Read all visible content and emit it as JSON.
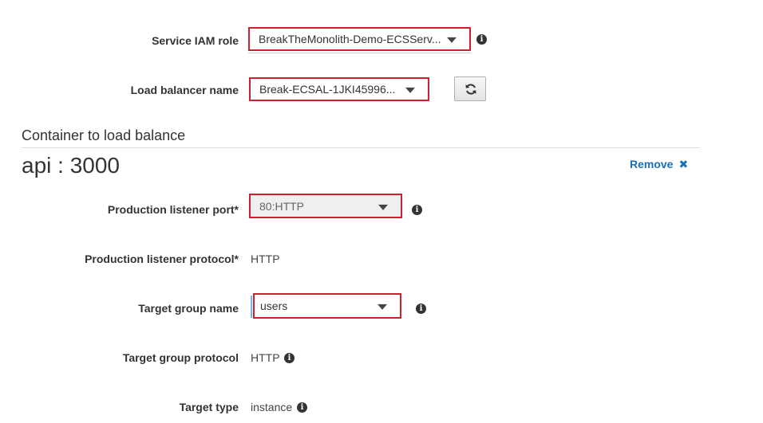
{
  "service_role": {
    "label": "Service IAM role",
    "value": "BreakTheMonolith-Demo-ECSServ..."
  },
  "load_balancer": {
    "label": "Load balancer name",
    "value": "Break-ECSAL-1JKI45996..."
  },
  "section": {
    "title": "Container to load balance",
    "container": "api : 3000",
    "remove_label": "Remove",
    "remove_icon": "✖"
  },
  "production_port": {
    "label": "Production listener port*",
    "value": "80:HTTP"
  },
  "production_protocol": {
    "label": "Production listener protocol*",
    "value": "HTTP"
  },
  "target_group_name": {
    "label": "Target group name",
    "value": "users"
  },
  "target_group_protocol": {
    "label": "Target group protocol",
    "value": "HTTP"
  },
  "target_type": {
    "label": "Target type",
    "value": "instance"
  },
  "icons": {
    "info": "i"
  },
  "colors": {
    "highlight_border": "#d0202e",
    "link": "#1a6fb5"
  }
}
